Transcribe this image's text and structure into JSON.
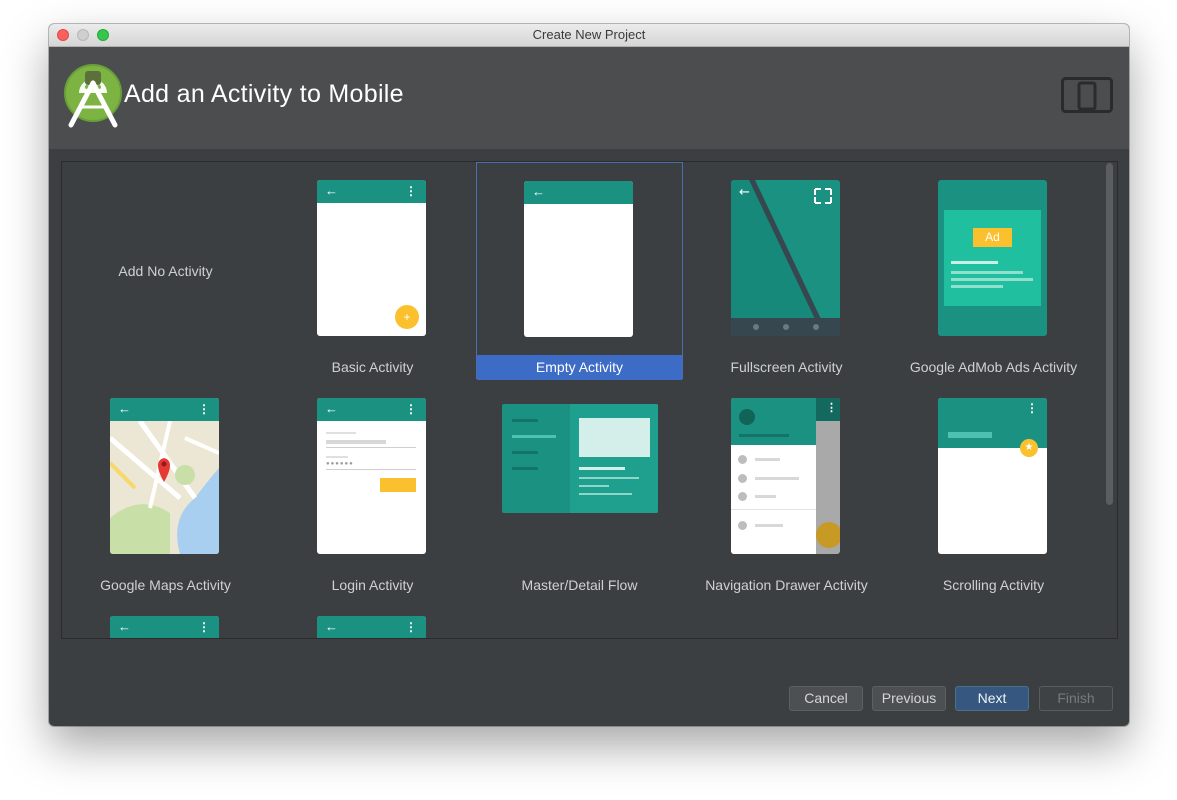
{
  "window": {
    "title": "Create New Project"
  },
  "header": {
    "title": "Add an Activity to Mobile",
    "logo_icon": "android-studio-logo",
    "device_icon": "tablet-phone-icon"
  },
  "gallery": {
    "selected": "Empty Activity",
    "items": [
      {
        "label": "Add No Activity"
      },
      {
        "label": "Basic Activity",
        "icon": "basic-activity-thumbnail"
      },
      {
        "label": "Empty Activity",
        "icon": "empty-activity-thumbnail"
      },
      {
        "label": "Fullscreen Activity",
        "icon": "fullscreen-activity-thumbnail"
      },
      {
        "label": "Google AdMob Ads Activity",
        "icon": "admob-activity-thumbnail",
        "ad_badge": "Ad"
      },
      {
        "label": "Google Maps Activity",
        "icon": "maps-activity-thumbnail"
      },
      {
        "label": "Login Activity",
        "icon": "login-activity-thumbnail"
      },
      {
        "label": "Master/Detail Flow",
        "icon": "master-detail-thumbnail"
      },
      {
        "label": "Navigation Drawer Activity",
        "icon": "nav-drawer-thumbnail"
      },
      {
        "label": "Scrolling Activity",
        "icon": "scrolling-activity-thumbnail"
      }
    ]
  },
  "buttons": {
    "cancel": "Cancel",
    "previous": "Previous",
    "next": "Next",
    "finish": "Finish"
  },
  "colors": {
    "accent_teal": "#1a9181",
    "selection_blue": "#3d6cc7",
    "fab_yellow": "#fbc02d",
    "background": "#3c3f41"
  }
}
